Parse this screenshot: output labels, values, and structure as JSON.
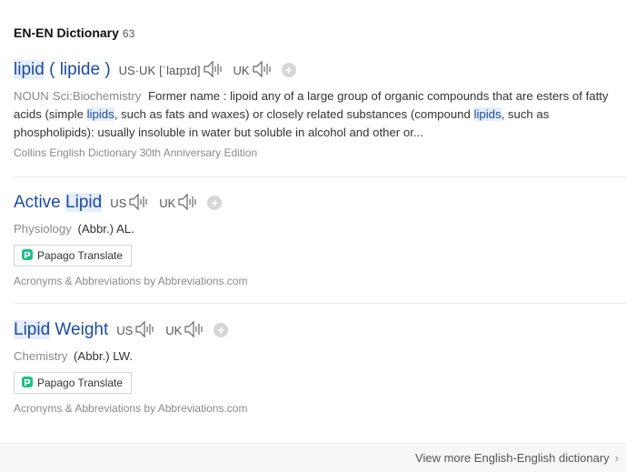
{
  "header": {
    "title": "EN-EN Dictionary",
    "count": "63"
  },
  "entries": [
    {
      "headword": "lipid",
      "headword_alt": "( lipide )",
      "pron_us_uk_label": "US·UK",
      "ipa": "[ˈlaɪpɪd]",
      "uk_label": "UK",
      "pos": "NOUN",
      "field": "Sci:Biochemistry",
      "def_parts": [
        "Former name : lipoid any of a large group of organic compounds that are esters of fatty acids (simple ",
        "lipids",
        ", such as fats and waxes) or closely related substances (compound ",
        "lipids",
        ", such as phospholipids): usually insoluble in water but soluble in alcohol and other or..."
      ],
      "source": "Collins English Dictionary 30th Anniversary Edition"
    },
    {
      "headword_pre": "Active ",
      "headword_hl": "Lipid",
      "us_label": "US",
      "uk_label": "UK",
      "field": "Physiology",
      "def": "(Abbr.) AL.",
      "translate": "Papago Translate",
      "source": "Acronyms & Abbreviations by Abbreviations.com"
    },
    {
      "headword_hl": "Lipid",
      "headword_post": " Weight",
      "us_label": "US",
      "uk_label": "UK",
      "field": "Chemistry",
      "def": "(Abbr.) LW.",
      "translate": "Papago Translate",
      "source": "Acronyms & Abbreviations by Abbreviations.com"
    }
  ],
  "footer": {
    "more_label": "View more English-English dictionary"
  },
  "icons": {
    "speaker": "speaker-icon",
    "add": "plus-icon",
    "papago": "papago-logo-icon",
    "chevron": "chevron-right-icon"
  },
  "colors": {
    "headword": "#1d4ba0",
    "highlight": "#e5eefa",
    "muted": "#8a8a8a"
  }
}
